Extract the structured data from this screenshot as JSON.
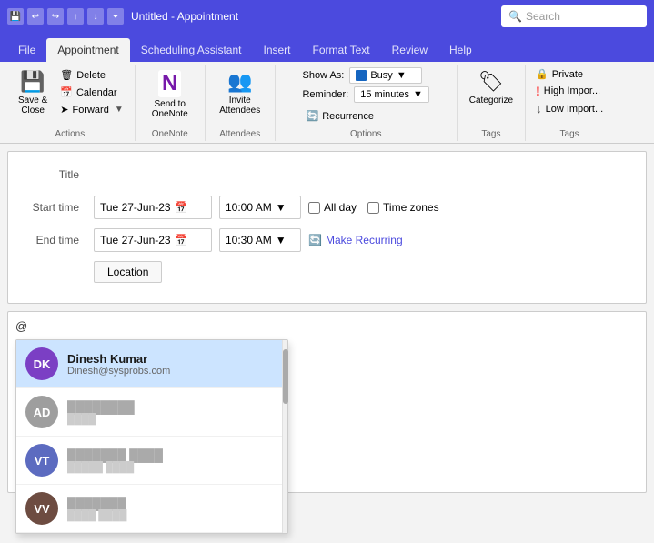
{
  "titleBar": {
    "title": "Untitled - Appointment",
    "searchPlaceholder": "Search"
  },
  "ribbon": {
    "tabs": [
      "File",
      "Appointment",
      "Scheduling Assistant",
      "Insert",
      "Format Text",
      "Review",
      "Help"
    ],
    "activeTab": "Appointment",
    "groups": {
      "actions": {
        "label": "Actions",
        "delete": "Delete",
        "calendar": "Calendar",
        "forward": "Forward"
      },
      "oneNote": {
        "label": "OneNote",
        "sendToOneNote": "Send to OneNote"
      },
      "attendees": {
        "label": "Attendees",
        "inviteAttendees": "Invite Attendees"
      },
      "options": {
        "label": "Options",
        "showAs": "Show As:",
        "busyStatus": "Busy",
        "reminder": "Reminder:",
        "reminderTime": "15 minutes",
        "recurrence": "Recurrence",
        "allDay": "All day",
        "timeZones": "Time zones"
      },
      "tags": {
        "label": "Tags",
        "categorize": "Categorize",
        "private": "Private",
        "highImportance": "High Impor...",
        "lowImportance": "Low Import..."
      }
    }
  },
  "appointment": {
    "titleLabel": "Title",
    "startTimeLabel": "Start time",
    "endTimeLabel": "End time",
    "locationLabel": "Location",
    "startDate": "Tue 27-Jun-23",
    "startTime": "10:00 AM",
    "endDate": "Tue 27-Jun-23",
    "endTime": "10:30 AM",
    "makeRecurring": "Make Recurring",
    "locationBtn": "Location"
  },
  "body": {
    "atMention": "@"
  },
  "autocomplete": {
    "items": [
      {
        "initials": "DK",
        "name": "Dinesh Kumar",
        "email": "Dinesh@sysprobs.com",
        "color": "#7b3fc4",
        "selected": true
      },
      {
        "initials": "AD",
        "name": "As...",
        "email": "ash...",
        "color": "#9e9e9e",
        "selected": false
      },
      {
        "initials": "VT",
        "name": "Vl... ...ova",
        "email": "v.t... ...net",
        "color": "#5c6bc0",
        "selected": false
      },
      {
        "initials": "VV",
        "name": "Va...",
        "email": "val... ...com",
        "color": "#6d4c41",
        "selected": false
      }
    ]
  },
  "icons": {
    "save": "💾",
    "delete": "🗑",
    "calendar": "📅",
    "forward": "➤",
    "oneNote": "N",
    "invite": "👤",
    "reminder": "🔔",
    "recurrence": "🔄",
    "categorize": "🏷",
    "search": "🔍",
    "chevronDown": "▼",
    "calIcon": "📅",
    "makeRecurring": "🔄",
    "private": "🔒",
    "highImportance": "!",
    "lowImportance": "↓",
    "undo": "↩",
    "redo": "↪",
    "up": "↑",
    "down": "↓",
    "history": "⏷"
  }
}
